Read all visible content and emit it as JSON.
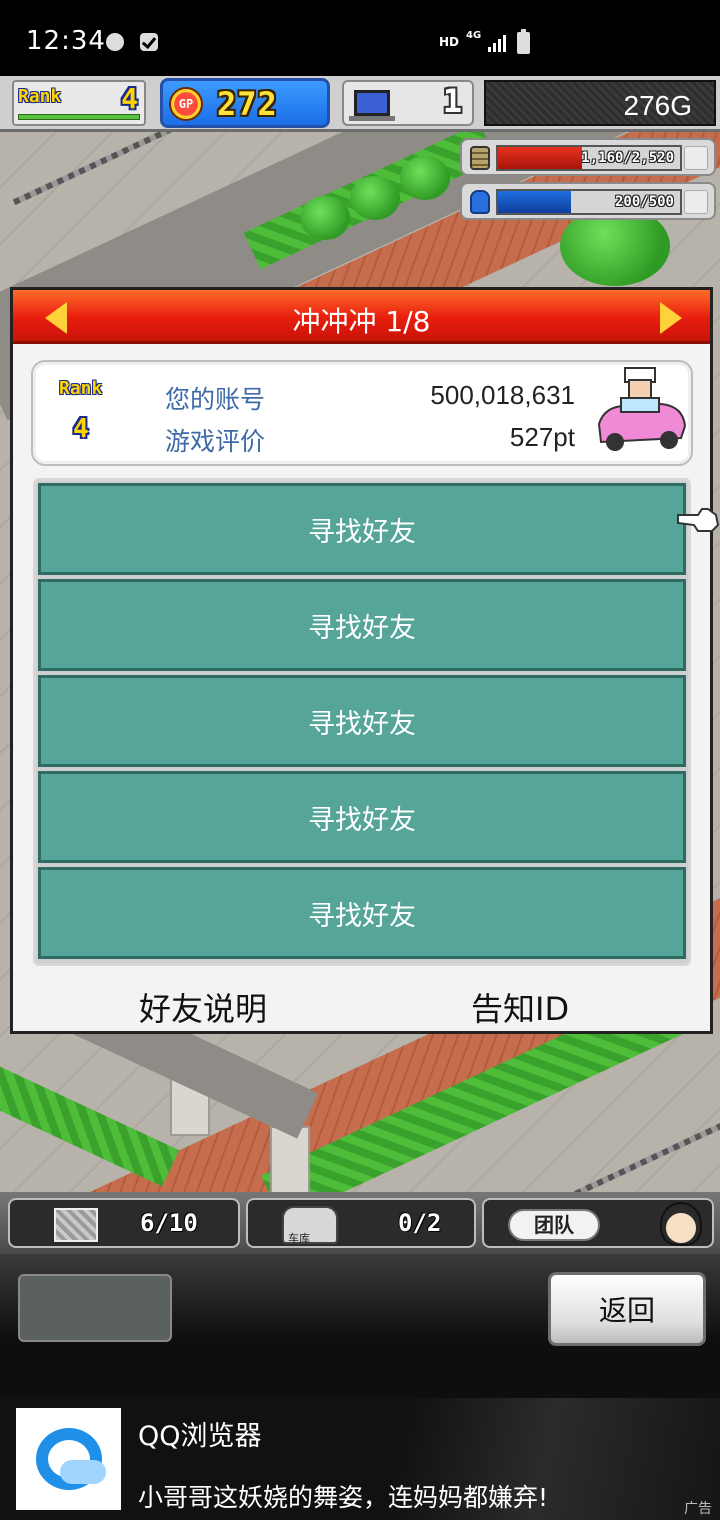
{
  "status_bar": {
    "time": "12:34",
    "network": "HD",
    "network_type": "4G"
  },
  "hud": {
    "rank_label": "Rank",
    "rank_value": "4",
    "gp_label": "GP",
    "gp_value": "272",
    "computers": "1",
    "money": "276G",
    "resource_1": "1,160/2,520",
    "resource_1_fraction": 0.46,
    "resource_2": "200/500",
    "resource_2_fraction": 0.4
  },
  "dialog": {
    "title": "冲冲冲 1/8",
    "rank_label": "Rank",
    "rank_value": "4",
    "account_label": "您的账号",
    "account_value": "500,018,631",
    "rating_label": "游戏评价",
    "rating_value": "527pt",
    "friend_slots": [
      "寻找好友",
      "寻找好友",
      "寻找好友",
      "寻找好友",
      "寻找好友"
    ],
    "footer_left": "好友说明",
    "footer_right": "告知ID"
  },
  "bottom_bar": {
    "tab1_value": "6/10",
    "tab2_caption": "车库",
    "tab2_value": "0/2",
    "tab3_label": "团队",
    "back_label": "返回"
  },
  "ad": {
    "title": "QQ浏览器",
    "text": "小哥哥这妖娆的舞姿，连妈妈都嫌弃!",
    "badge": "广告"
  },
  "colors": {
    "header_red": "#e81d0d",
    "slot_teal": "#55a698",
    "label_blue": "#3e6aa8",
    "resource_1_fill": "#e8321e",
    "resource_2_fill": "#1e6fe0"
  }
}
